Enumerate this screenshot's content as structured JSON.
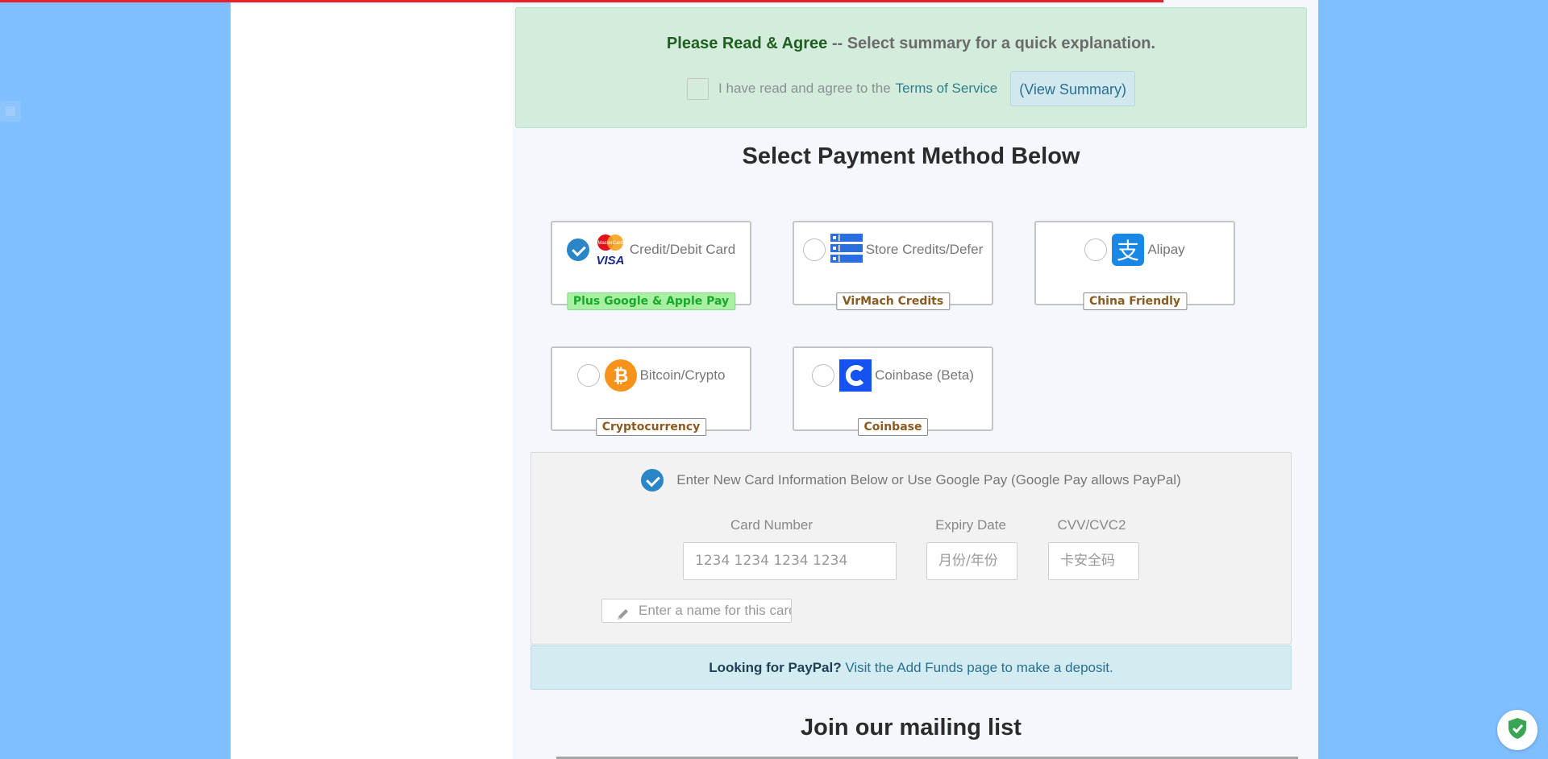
{
  "agree": {
    "title_strong": "Please Read & Agree",
    "title_rest": " -- Select summary for a quick explanation.",
    "checkbox_text": "I have read and agree to the",
    "tos_link": "Terms of Service",
    "summary_button": "(View Summary)"
  },
  "payment": {
    "heading": "Select Payment Method Below",
    "methods": [
      {
        "label": "Credit/Debit Card",
        "badge": "Plus Google & Apple Pay",
        "selected": true,
        "icon": "mastercard-visa-icon"
      },
      {
        "label": "Store Credits/Defer",
        "badge": "VirMach Credits",
        "selected": false,
        "icon": "server-stack-icon"
      },
      {
        "label": "Alipay",
        "badge": "China Friendly",
        "selected": false,
        "icon": "alipay-icon"
      },
      {
        "label": "Bitcoin/Crypto",
        "badge": "Cryptocurrency",
        "selected": false,
        "icon": "bitcoin-icon"
      },
      {
        "label": "Coinbase (Beta)",
        "badge": "Coinbase",
        "selected": false,
        "icon": "coinbase-icon"
      }
    ]
  },
  "card": {
    "option_label": "Enter New Card Information Below or Use Google Pay (Google Pay allows PayPal)",
    "number_label": "Card Number",
    "number_placeholder": "1234 1234 1234 1234",
    "expiry_label": "Expiry Date",
    "expiry_placeholder": "月份/年份",
    "cvv_label": "CVV/CVC2",
    "cvv_placeholder": "卡安全码",
    "name_placeholder": "Enter a name for this card"
  },
  "paypal": {
    "strong": "Looking for PayPal?",
    "text_before": " Visit the ",
    "link": "Add Funds",
    "text_after": " page to make a deposit."
  },
  "mailing": {
    "heading": "Join our mailing list"
  },
  "colors": {
    "accent": "#2a86c7",
    "background": "#7fbfff",
    "progress": "#e8202a"
  }
}
